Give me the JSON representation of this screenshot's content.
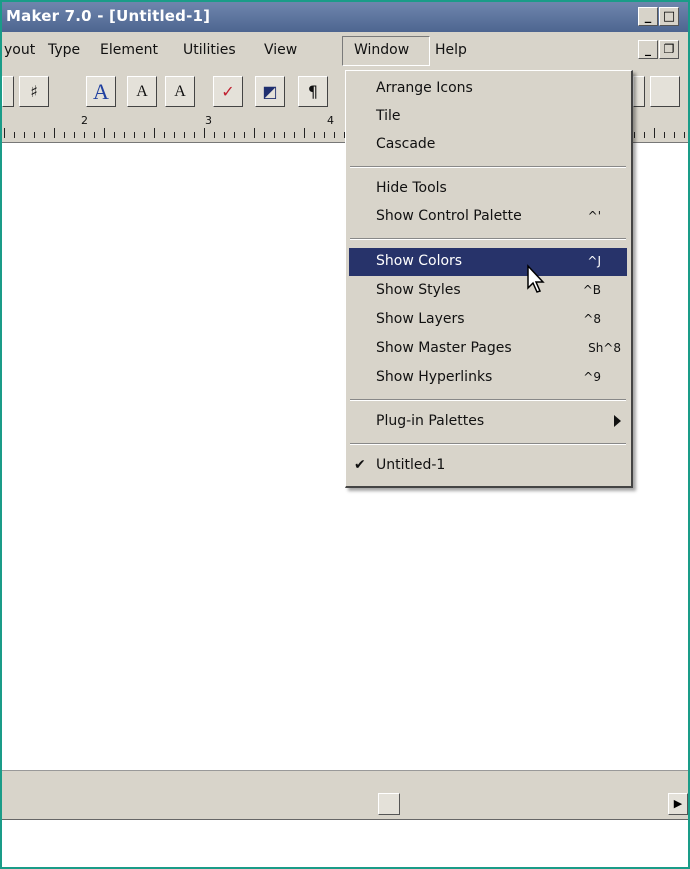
{
  "window": {
    "title": "Maker 7.0 - [Untitled-1]"
  },
  "title_buttons": {
    "minimize": "_",
    "restore": "□"
  },
  "menubar": {
    "items": [
      "yout",
      "Type",
      "Element",
      "Utilities",
      "View",
      "Window",
      "Help"
    ]
  },
  "mdi_buttons": {
    "minimize": "_",
    "restore": "❐"
  },
  "toolbar": {
    "icons": [
      "binoculars-icon",
      "text-tool-icon",
      "superscript-icon",
      "subscript-icon",
      "spellcheck-icon",
      "fill-icon",
      "paragraph-icon"
    ],
    "glyphs": [
      "♯",
      "A",
      "A",
      "A",
      "✓",
      "◩",
      "¶"
    ]
  },
  "ruler": {
    "labels": [
      "2",
      "3",
      "4"
    ]
  },
  "window_menu": {
    "items": [
      {
        "label": "Arrange Icons",
        "shortcut": ""
      },
      {
        "label": "Tile",
        "shortcut": ""
      },
      {
        "label": "Cascade",
        "shortcut": ""
      },
      {
        "label": "Hide Tools",
        "shortcut": ""
      },
      {
        "label": "Show Control Palette",
        "shortcut": "^'"
      },
      {
        "label": "Show Colors",
        "shortcut": "^J"
      },
      {
        "label": "Show Styles",
        "shortcut": "^B"
      },
      {
        "label": "Show Layers",
        "shortcut": "^8"
      },
      {
        "label": "Show Master Pages",
        "shortcut": "Sh^8"
      },
      {
        "label": "Show Hyperlinks",
        "shortcut": "^9"
      },
      {
        "label": "Plug-in Palettes",
        "shortcut": ""
      },
      {
        "label": "Untitled-1",
        "shortcut": ""
      }
    ],
    "selected": "Show Colors",
    "checked": "Untitled-1"
  },
  "colors": {
    "titlebar": "#5a7199",
    "highlight": "#27336a",
    "frame_border": "#1a9c88",
    "chrome": "#d8d4ca"
  }
}
